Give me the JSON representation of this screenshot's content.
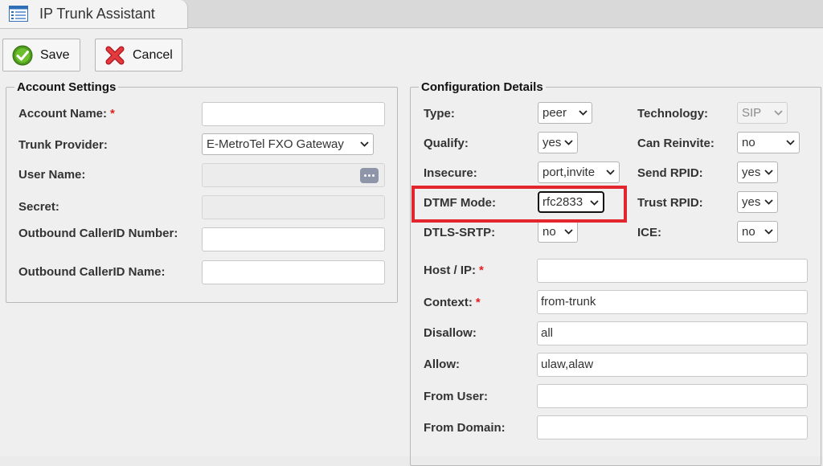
{
  "tab": {
    "title": "IP Trunk Assistant",
    "icon": "list-window-icon"
  },
  "toolbar": {
    "save_label": "Save",
    "cancel_label": "Cancel"
  },
  "account_settings": {
    "legend": "Account Settings",
    "fields": {
      "account_name": {
        "label": "Account Name:",
        "required": "*",
        "value": ""
      },
      "trunk_provider": {
        "label": "Trunk Provider:",
        "value": "E-MetroTel FXO Gateway"
      },
      "user_name": {
        "label": "User Name:",
        "value": ""
      },
      "secret": {
        "label": "Secret:",
        "value": ""
      },
      "outbound_callerid_number": {
        "label": "Outbound CallerID Number:",
        "value": ""
      },
      "outbound_callerid_name": {
        "label": "Outbound CallerID Name:",
        "value": ""
      }
    }
  },
  "configuration_details": {
    "legend": "Configuration Details",
    "selects": {
      "type": {
        "label": "Type:",
        "value": "peer"
      },
      "technology": {
        "label": "Technology:",
        "value": "SIP"
      },
      "qualify": {
        "label": "Qualify:",
        "value": "yes"
      },
      "can_reinvite": {
        "label": "Can Reinvite:",
        "value": "no"
      },
      "insecure": {
        "label": "Insecure:",
        "value": "port,invite"
      },
      "send_rpid": {
        "label": "Send RPID:",
        "value": "yes"
      },
      "dtmf_mode": {
        "label": "DTMF Mode:",
        "value": "rfc2833"
      },
      "trust_rpid": {
        "label": "Trust RPID:",
        "value": "yes"
      },
      "dtls_srtp": {
        "label": "DTLS-SRTP:",
        "value": "no"
      },
      "ice": {
        "label": "ICE:",
        "value": "no"
      }
    },
    "inputs": {
      "host_ip": {
        "label": "Host / IP:",
        "required": "*",
        "value": ""
      },
      "context": {
        "label": "Context:",
        "required": "*",
        "value": "from-trunk"
      },
      "disallow": {
        "label": "Disallow:",
        "value": "all"
      },
      "allow": {
        "label": "Allow:",
        "value": "ulaw,alaw"
      },
      "from_user": {
        "label": "From User:",
        "value": ""
      },
      "from_domain": {
        "label": "From Domain:",
        "value": ""
      }
    }
  },
  "colors": {
    "highlight": "#e3262d",
    "required": "#e02020",
    "save_icon": "#4e9a1e",
    "cancel_icon": "#d8262c"
  }
}
